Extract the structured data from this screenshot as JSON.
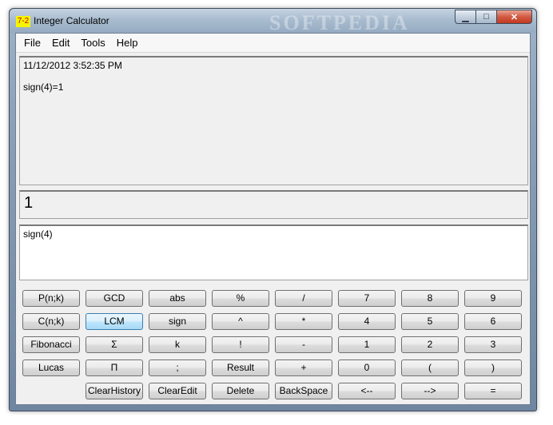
{
  "window": {
    "icon_text": "7-2",
    "title": "Integer Calculator",
    "watermark": "SOFTPEDIA",
    "minimize_glyph": "▁",
    "maximize_glyph": "□",
    "close_glyph": "✕"
  },
  "menu": [
    "File",
    "Edit",
    "Tools",
    "Help"
  ],
  "history": {
    "timestamp": "11/12/2012 3:52:35 PM",
    "entry": "sign(4)=1"
  },
  "result": "1",
  "input": "sign(4)",
  "keys": [
    [
      "P(n;k)",
      "GCD",
      "abs",
      "%",
      "/",
      "7",
      "8",
      "9"
    ],
    [
      "C(n;k)",
      "LCM",
      "sign",
      "^",
      "*",
      "4",
      "5",
      "6"
    ],
    [
      "Fibonacci",
      "Σ",
      "k",
      "!",
      "-",
      "1",
      "2",
      "3"
    ],
    [
      "Lucas",
      "Π",
      ";",
      "Result",
      "+",
      "0",
      "(",
      ")"
    ],
    [
      "",
      "ClearHistory",
      "ClearEdit",
      "Delete",
      "BackSpace",
      "<--",
      "-->",
      "="
    ]
  ],
  "highlighted_key": "LCM"
}
